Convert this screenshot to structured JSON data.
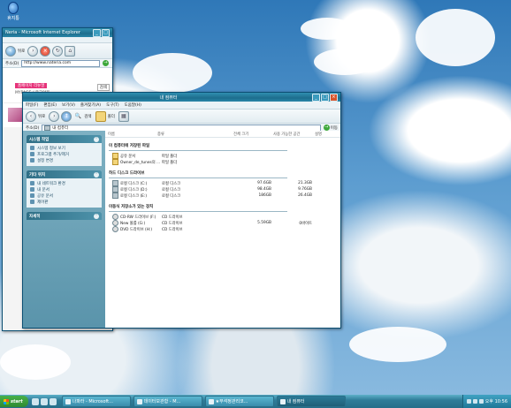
{
  "desktop": {
    "icon_label": "휴지통"
  },
  "ie_window": {
    "title": "Neria - Microsoft Internet Explorer",
    "back_label": "뒤로",
    "address_label": "주소(D)",
    "address_value": "http://www.nateria.com",
    "page_banner": "홈페이지 리뉴얼",
    "page_links": "MYPAGE / 로그아웃",
    "page_button": "검색"
  },
  "explorer": {
    "title": "내 컴퓨터",
    "menu": [
      "파일(F)",
      "편집(E)",
      "보기(V)",
      "즐겨찾기(A)",
      "도구(T)",
      "도움말(H)"
    ],
    "toolbar": {
      "back": "뒤로",
      "search": "검색",
      "folders": "폴더"
    },
    "address_label": "주소(D)",
    "address_value": "내 컴퓨터",
    "go_label": "이동",
    "tasks_panel": {
      "title": "시스템 작업",
      "items": [
        "시스템 정보 보기",
        "프로그램 추가/제거",
        "설정 변경"
      ]
    },
    "places_panel": {
      "title": "기타 위치",
      "items": [
        "내 네트워크 환경",
        "내 문서",
        "공유 문서",
        "제어판"
      ]
    },
    "details_panel": {
      "title": "자세히"
    },
    "columns": [
      "이름",
      "종류",
      "전체 크기",
      "사용 가능한 공간",
      "설명"
    ],
    "sections": [
      {
        "title": "이 컴퓨터에 저장된 파일",
        "rows": [
          {
            "name": "공유 문서",
            "type": "파일 폴더",
            "total": "",
            "free": "",
            "icon": "folder"
          },
          {
            "name": "Owner_de_tunes의 ...",
            "type": "파일 폴더",
            "total": "",
            "free": "",
            "icon": "folder"
          }
        ]
      },
      {
        "title": "하드 디스크 드라이브",
        "rows": [
          {
            "name": "로컬 디스크 (C:)",
            "type": "로컬 디스크",
            "total": "97.6GB",
            "free": "21.3GB",
            "icon": "disk"
          },
          {
            "name": "로컬 디스크 (D:)",
            "type": "로컬 디스크",
            "total": "98.4GB",
            "free": "9.76GB",
            "icon": "disk"
          },
          {
            "name": "로컬 디스크 (E:)",
            "type": "로컬 디스크",
            "total": "186GB",
            "free": "26.4GB",
            "icon": "disk"
          }
        ]
      },
      {
        "title": "이동식 저장소가 있는 장치",
        "rows": [
          {
            "name": "CD-RW 드라이브 (F:)",
            "type": "CD 드라이브",
            "total": "",
            "free": "",
            "icon": "cd"
          },
          {
            "name": "New 볼륨 (G:)",
            "type": "CD 드라이브",
            "total": "5.59GB",
            "free": "0바이트",
            "icon": "cd"
          },
          {
            "name": "DVD 드라이브 (H:)",
            "type": "CD 드라이브",
            "total": "",
            "free": "",
            "icon": "cd"
          }
        ]
      }
    ]
  },
  "taskbar": {
    "start": "start",
    "tasks": [
      "나파라 - Microsoft...",
      "데이터보관함 - M...",
      "★부석정관리코...",
      "내 컴퓨터"
    ],
    "clock": "오후 10:56"
  }
}
